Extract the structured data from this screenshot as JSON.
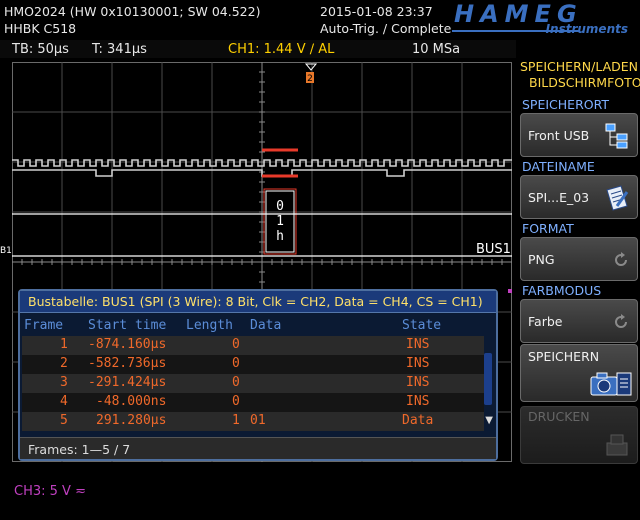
{
  "header": {
    "model": "HMO2024 (HW 0x10130001; SW 04.522)",
    "option": "HHBK C518",
    "datetime": "2015-01-08 23:37",
    "trigger_status": "Auto-Trig. / Complete",
    "logo_brand": "HAMEG",
    "logo_sub": "Instruments"
  },
  "statusbar": {
    "timebase": "TB: 50µs",
    "trigger_time": "T: 341µs",
    "ch1": "CH1: 1.44 V ∕ AL",
    "sample_rate": "10 MSa"
  },
  "waveform": {
    "bus_label": "BUS1",
    "b1_marker": "B1",
    "trigger_marker": "2",
    "decoded_chars": [
      "0",
      "1",
      "h"
    ],
    "colors": {
      "bus": "#ffffff",
      "frame": "#e83a2a",
      "grid": "#6a6a6a"
    }
  },
  "bus_table": {
    "title": "Bustabelle: BUS1 (SPI (3 Wire): 8 Bit, Clk = CH2, Data = CH4, CS = CH1)",
    "columns": [
      "Frame",
      "Start time",
      "Length",
      "Data",
      "State"
    ],
    "rows": [
      {
        "frame": "1",
        "start": "-874.160µs",
        "length": "0",
        "data": "",
        "state": "INS"
      },
      {
        "frame": "2",
        "start": "-582.736µs",
        "length": "0",
        "data": "",
        "state": "INS"
      },
      {
        "frame": "3",
        "start": "-291.424µs",
        "length": "0",
        "data": "",
        "state": "INS"
      },
      {
        "frame": "4",
        "start": "-48.000ns",
        "length": "0",
        "data": "",
        "state": "INS"
      },
      {
        "frame": "5",
        "start": "291.280µs",
        "length": "1",
        "data": "01",
        "state": "Data"
      }
    ],
    "footer": "Frames: 1—5 / 7"
  },
  "sidebar": {
    "title_line1": "SPEICHERN/LADEN",
    "title_line2": "BILDSCHIRMFOTO",
    "location_label": "SPEICHERORT",
    "location_value": "Front USB",
    "filename_label": "DATEINAME",
    "filename_value": "SPI...E_03",
    "format_label": "FORMAT",
    "format_value": "PNG",
    "colormode_label": "FARBMODUS",
    "colormode_value": "Farbe",
    "save_label": "SPEICHERN",
    "print_label": "DRUCKEN"
  },
  "footer": {
    "ch3": "CH3: 5 V ≂"
  }
}
